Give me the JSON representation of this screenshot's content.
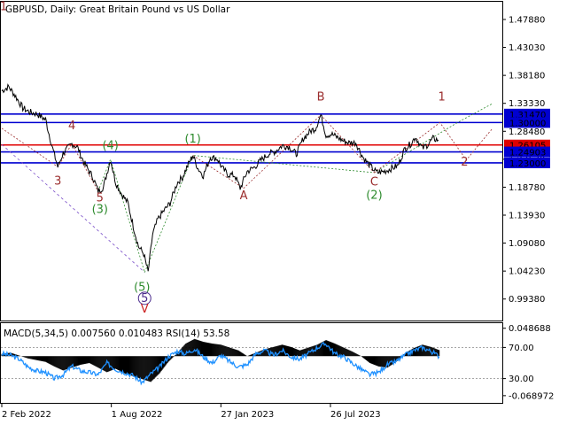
{
  "chart_data": [
    {
      "type": "line",
      "title": "GBPUSD, Daily:  Great Britain Pound vs US Dollar",
      "ylim": [
        0.9565,
        1.5095
      ],
      "yticks": [
        "1.47880",
        "1.43030",
        "1.38180",
        "1.33330",
        "1.28480",
        "1.23630",
        "1.18780",
        "1.13930",
        "1.09080",
        "1.04230",
        "0.99380"
      ],
      "xticks": [
        {
          "i": 0,
          "label": "2 Feb 2022"
        },
        {
          "i": 125,
          "label": "1 Aug 2022"
        },
        {
          "i": 250,
          "label": "27 Jan 2023"
        },
        {
          "i": 375,
          "label": "26 Jul 2023"
        }
      ],
      "series": [
        {
          "type": "line",
          "points": [
            [
              0,
              1.355
            ],
            [
              8,
              1.362
            ],
            [
              16,
              1.345
            ],
            [
              24,
              1.325
            ],
            [
              32,
              1.318
            ],
            [
              40,
              1.315
            ],
            [
              50,
              1.305
            ],
            [
              58,
              1.255
            ],
            [
              64,
              1.223
            ],
            [
              70,
              1.247
            ],
            [
              80,
              1.263
            ],
            [
              86,
              1.258
            ],
            [
              94,
              1.23
            ],
            [
              104,
              1.205
            ],
            [
              110,
              1.181
            ],
            [
              116,
              1.188
            ],
            [
              124,
              1.236
            ],
            [
              130,
              1.196
            ],
            [
              136,
              1.178
            ],
            [
              144,
              1.16
            ],
            [
              150,
              1.12
            ],
            [
              156,
              1.085
            ],
            [
              162,
              1.072
            ],
            [
              167,
              1.04
            ],
            [
              172,
              1.105
            ],
            [
              178,
              1.132
            ],
            [
              184,
              1.145
            ],
            [
              192,
              1.16
            ],
            [
              200,
              1.195
            ],
            [
              206,
              1.205
            ],
            [
              212,
              1.225
            ],
            [
              218,
              1.243
            ],
            [
              224,
              1.22
            ],
            [
              230,
              1.208
            ],
            [
              238,
              1.24
            ],
            [
              246,
              1.237
            ],
            [
              252,
              1.22
            ],
            [
              258,
              1.21
            ],
            [
              266,
              1.208
            ],
            [
              272,
              1.186
            ],
            [
              280,
              1.215
            ],
            [
              288,
              1.222
            ],
            [
              296,
              1.235
            ],
            [
              304,
              1.245
            ],
            [
              312,
              1.25
            ],
            [
              320,
              1.26
            ],
            [
              328,
              1.258
            ],
            [
              336,
              1.245
            ],
            [
              344,
              1.272
            ],
            [
              352,
              1.285
            ],
            [
              358,
              1.29
            ],
            [
              364,
              1.313
            ],
            [
              370,
              1.278
            ],
            [
              376,
              1.28
            ],
            [
              382,
              1.275
            ],
            [
              390,
              1.268
            ],
            [
              396,
              1.265
            ],
            [
              404,
              1.265
            ],
            [
              412,
              1.24
            ],
            [
              420,
              1.225
            ],
            [
              428,
              1.213
            ],
            [
              436,
              1.215
            ],
            [
              444,
              1.22
            ],
            [
              452,
              1.225
            ],
            [
              460,
              1.255
            ],
            [
              466,
              1.262
            ],
            [
              472,
              1.275
            ],
            [
              480,
              1.255
            ],
            [
              486,
              1.262
            ],
            [
              492,
              1.272
            ],
            [
              498,
              1.27
            ]
          ]
        }
      ],
      "hlines": [
        {
          "label": "1.31470",
          "value": 1.3147,
          "color": "#0000d0"
        },
        {
          "label": "1.30000",
          "value": 1.3,
          "color": "#0000d0"
        },
        {
          "label": "1.26105",
          "value": 1.26105,
          "color": "#e00000"
        },
        {
          "label": "1.24903",
          "value": 1.24903,
          "color": "#0000d0"
        },
        {
          "label": "1.23000",
          "value": 1.23,
          "color": "#0000d0"
        }
      ],
      "wave_labels": [
        {
          "text": "1",
          "i": 2,
          "y": 1.495,
          "color": "#9b2d2d"
        },
        {
          "text": "4",
          "i": 80,
          "y": 1.288,
          "color": "#9b2d2d"
        },
        {
          "text": "3",
          "i": 64,
          "y": 1.192,
          "color": "#9b2d2d"
        },
        {
          "text": "5",
          "i": 112,
          "y": 1.163,
          "color": "#9b2d2d"
        },
        {
          "text": "(4)",
          "i": 124,
          "y": 1.254,
          "color": "#2e8b2e"
        },
        {
          "text": "(3)",
          "i": 112,
          "y": 1.143,
          "color": "#2e8b2e"
        },
        {
          "text": "(1)",
          "i": 218,
          "y": 1.265,
          "color": "#2e8b2e"
        },
        {
          "text": "(5)",
          "i": 160,
          "y": 1.008,
          "color": "#2e8b2e"
        },
        {
          "text": "5",
          "i": 163,
          "y": 0.989,
          "color": "#4b2c8c",
          "circle": true
        },
        {
          "text": "V",
          "i": 163,
          "y": 0.97,
          "color": "#cc2222"
        },
        {
          "text": "A",
          "i": 276,
          "y": 1.167,
          "color": "#9b2d2d"
        },
        {
          "text": "B",
          "i": 364,
          "y": 1.338,
          "color": "#9b2d2d"
        },
        {
          "text": "C",
          "i": 425,
          "y": 1.191,
          "color": "#9b2d2d"
        },
        {
          "text": "(2)",
          "i": 425,
          "y": 1.168,
          "color": "#2e8b2e"
        },
        {
          "text": "1",
          "i": 502,
          "y": 1.338,
          "color": "#9b2d2d"
        },
        {
          "text": "2",
          "i": 528,
          "y": 1.225,
          "color": "#9b2d2d"
        }
      ],
      "paths": [
        {
          "color": "#7a4fc9",
          "dash": "3,3",
          "points": [
            [
              0,
              1.262
            ],
            [
              163,
              1.04
            ]
          ]
        },
        {
          "color": "#9b2d2d",
          "dash": "2,2",
          "points": [
            [
              0,
              1.29
            ],
            [
              64,
              1.223
            ],
            [
              80,
              1.263
            ],
            [
              110,
              1.181
            ]
          ]
        },
        {
          "color": "#2e8b2e",
          "dash": "2,2",
          "points": [
            [
              110,
              1.181
            ],
            [
              124,
              1.236
            ],
            [
              163,
              1.04
            ]
          ]
        },
        {
          "color": "#2e8b2e",
          "dash": "2,2",
          "points": [
            [
              163,
              1.04
            ],
            [
              218,
              1.243
            ],
            [
              425,
              1.213
            ],
            [
              520,
              1.3
            ],
            [
              560,
              1.333
            ]
          ]
        },
        {
          "color": "#9b2d2d",
          "dash": "2,2",
          "points": [
            [
              218,
              1.243
            ],
            [
              276,
              1.186
            ],
            [
              364,
              1.313
            ],
            [
              425,
              1.213
            ]
          ]
        },
        {
          "color": "#9b2d2d",
          "dash": "2,2",
          "points": [
            [
              425,
              1.213
            ],
            [
              500,
              1.3
            ],
            [
              530,
              1.235
            ],
            [
              560,
              1.29
            ]
          ]
        }
      ]
    },
    {
      "type": "line",
      "title": "MACD(5,34,5) 0.007560 0.010483 RSI(14) 53.58",
      "ylim": [
        -0.08,
        0.056
      ],
      "yticks": [
        "0.048688",
        "70.00",
        "30.00",
        "-0.068972"
      ],
      "rsi_levels": [
        70,
        30
      ],
      "series": [
        {
          "name": "MACD",
          "type": "bar",
          "x": [
            0,
            10,
            20,
            30,
            40,
            50,
            60,
            70,
            80,
            90,
            100,
            110,
            120,
            130,
            140,
            150,
            160,
            170,
            180,
            190,
            200,
            210,
            220,
            230,
            240,
            250,
            260,
            270,
            280,
            290,
            300,
            310,
            320,
            330,
            340,
            350,
            360,
            370,
            380,
            390,
            400,
            410,
            420,
            430,
            440,
            450,
            460,
            470,
            480,
            490,
            500
          ],
          "values": [
            0.004,
            0.006,
            0.001,
            -0.004,
            -0.007,
            -0.01,
            -0.018,
            -0.025,
            -0.02,
            -0.015,
            -0.012,
            -0.02,
            -0.028,
            -0.022,
            -0.03,
            -0.035,
            -0.04,
            -0.045,
            -0.03,
            -0.01,
            0.005,
            0.022,
            0.03,
            0.025,
            0.022,
            0.02,
            0.015,
            0.01,
            0.0,
            0.006,
            0.012,
            0.016,
            0.02,
            0.016,
            0.01,
            0.015,
            0.02,
            0.028,
            0.022,
            0.015,
            0.008,
            0.0,
            -0.012,
            -0.018,
            -0.02,
            -0.01,
            0.005,
            0.014,
            0.02,
            0.016,
            0.01
          ]
        },
        {
          "name": "RSI",
          "type": "line",
          "x": [
            0,
            10,
            20,
            30,
            40,
            50,
            60,
            70,
            80,
            90,
            100,
            110,
            120,
            130,
            140,
            150,
            160,
            170,
            180,
            190,
            200,
            210,
            220,
            230,
            240,
            250,
            260,
            270,
            280,
            290,
            300,
            310,
            320,
            330,
            340,
            350,
            360,
            370,
            380,
            390,
            400,
            410,
            420,
            430,
            440,
            450,
            460,
            470,
            480,
            490,
            500
          ],
          "values": [
            62,
            60,
            55,
            45,
            40,
            38,
            30,
            35,
            46,
            40,
            38,
            35,
            50,
            42,
            38,
            34,
            25,
            36,
            45,
            58,
            65,
            62,
            68,
            58,
            50,
            60,
            52,
            45,
            48,
            62,
            66,
            60,
            66,
            58,
            55,
            62,
            70,
            75,
            62,
            58,
            50,
            42,
            35,
            38,
            48,
            52,
            60,
            66,
            70,
            65,
            58
          ]
        }
      ]
    }
  ]
}
